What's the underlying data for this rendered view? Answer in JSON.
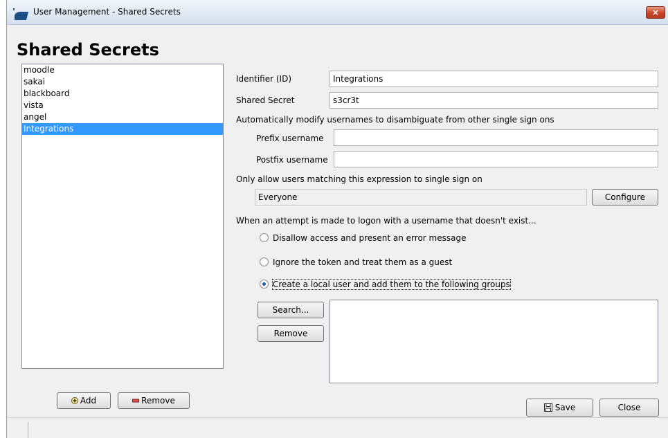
{
  "window": {
    "title": "User Management - Shared Secrets",
    "close_glyph": "×"
  },
  "heading": "Shared Secrets",
  "secrets_list": {
    "items": [
      "moodle",
      "sakai",
      "blackboard",
      "vista",
      "angel",
      "Integrations"
    ],
    "selected": "Integrations"
  },
  "list_buttons": {
    "add_label": "Add",
    "add_icon": "plus-icon",
    "remove_label": "Remove",
    "remove_icon": "minus-icon"
  },
  "form": {
    "identifier_label": "Identifier (ID)",
    "identifier_value": "Integrations",
    "secret_label": "Shared Secret",
    "secret_value": "s3cr3t",
    "modify_note": "Automatically modify usernames to disambiguate from other single sign ons",
    "prefix_label": "Prefix username",
    "prefix_value": "",
    "postfix_label": "Postfix username",
    "postfix_value": "",
    "expression_note": "Only allow users matching this expression to single sign on",
    "expression_value": "Everyone",
    "configure_label": "Configure",
    "nonexist_note": "When an attempt is made to logon with a username that doesn't exist...",
    "radio_options": [
      "Disallow access and present an error message",
      "Ignore the token and treat them as a guest",
      "Create a local user and add them to the following groups"
    ],
    "radio_selected": 2,
    "search_label": "Search...",
    "group_remove_label": "Remove"
  },
  "footer": {
    "save_label": "Save",
    "save_icon": "floppy-icon",
    "close_label": "Close"
  },
  "colors": {
    "selection": "#3399ff",
    "titlebar": "#dfe8f3",
    "close": "#c9452a"
  }
}
